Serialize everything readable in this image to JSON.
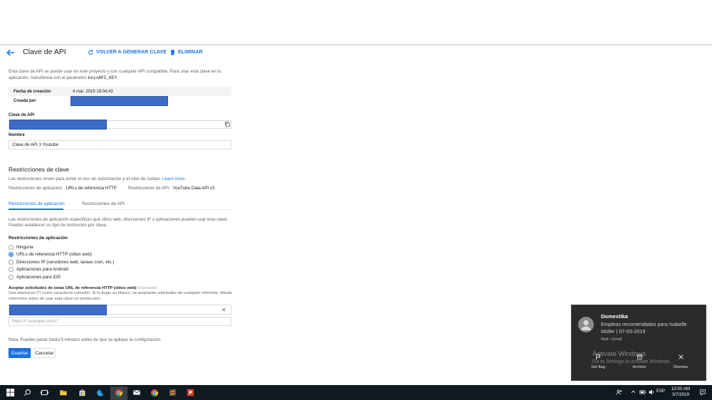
{
  "header": {
    "title": "Clave de API",
    "regen_label": "VOLVER A GENERAR CLAVE",
    "delete_label": "ELIMINAR"
  },
  "intro": {
    "text": "Esta clave de API se puede usar en este proyecto y con cualquier API compatible. Para usar esta clave en tu aplicación, transfiérela con el parámetro ",
    "param": "key=API_KEY",
    "end": "."
  },
  "meta": {
    "created_label": "Fecha de creación",
    "created_value": "4 mar. 2019 18:04:43",
    "author_label": "Creada por"
  },
  "api_key": {
    "label": "Clave de API"
  },
  "name": {
    "label": "Nombre",
    "value": "Clave de API 3 Youtube"
  },
  "restrictions": {
    "title": "Restricciones de clave",
    "desc": "Las restricciones sirven para evitar el uso sin autorización y el robo de cuotas. ",
    "learn_more": "Learn more",
    "app_label": "Restricciones de aplicación:",
    "app_value": "URLs de referencia HTTP",
    "api_label": "Restricciones de API:",
    "api_value": "YouTube Data API v3"
  },
  "tabs": [
    {
      "label": "Restricciones de aplicación"
    },
    {
      "label": "Restricciones de API"
    }
  ],
  "app_restrictions": {
    "desc": "Las restricciones de aplicación especifican qué sitios web, direcciones IP o aplicaciones pueden usar esta clave. Puedes establecer un tipo de restricción por clave.",
    "heading": "Restricciones de aplicación",
    "options": [
      {
        "label": "Ninguna"
      },
      {
        "label": "URLs de referencia HTTP (sitios web)"
      },
      {
        "label": "Direcciones IP (servidores web, tareas cron, etc.)"
      },
      {
        "label": "Aplicaciones para Android"
      },
      {
        "label": "Aplicaciones para iOS"
      }
    ],
    "selected_index": 1
  },
  "referrers": {
    "label": "Aceptar solicitudes de estas URL de referencia HTTP (sitios web)",
    "optional": "(Opcional)",
    "help": "Usa asteriscos (*) como caracteres comodín. Si lo dejas en blanco, se aceptarán solicitudes de cualquier referente. Añade referentes antes de usar esta clave en producción.",
    "placeholder": "https://*.example.com/*"
  },
  "note": "Nota: Pueden pasar hasta 5 minutos antes de que se aplique la configuración.",
  "actions": {
    "save": "Guardar",
    "cancel": "Cancelar"
  },
  "notification": {
    "app": "Domestika",
    "body": "Empleos recomendados para Isabelle Müller | 07-03-2019",
    "source": "Mail • Gmail",
    "actions": [
      "Set flag",
      "Archive",
      "Dismiss"
    ],
    "watermark_title": "Activate Windows",
    "watermark_sub": "Go to Settings to activate Windows."
  },
  "taskbar": {
    "language": "ESP",
    "time": "10:00 AM",
    "date": "3/7/2019"
  },
  "colors": {
    "accent": "#1a73e8",
    "redaction": "#3d6cc7",
    "taskbar": "#101820",
    "toast": "#2b2b2b"
  }
}
